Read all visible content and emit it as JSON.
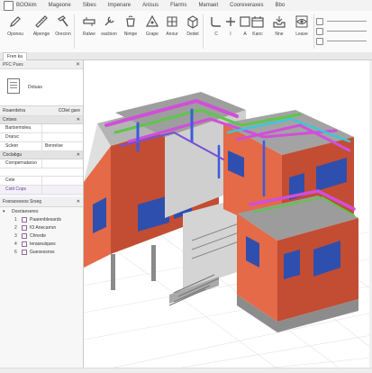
{
  "menubar": {
    "items": [
      "BOOkim",
      "Mageone",
      "Sibes",
      "Impenare",
      "Anisus",
      "Flarms",
      "Mamaet",
      "Coorexeraxes",
      "Bbo"
    ]
  },
  "ribbon": {
    "tools": [
      {
        "label": "Oponeu",
        "icon": "pencil-icon"
      },
      {
        "label": "Alpenge",
        "icon": "ruler-icon"
      },
      {
        "label": "Orecion",
        "icon": "hammer-icon"
      },
      {
        "label": "Ralwe",
        "icon": "pipe-icon"
      },
      {
        "label": "eacbion",
        "icon": "wrench-icon"
      },
      {
        "label": "Nimpe",
        "icon": "bucket-icon"
      },
      {
        "label": "Grape",
        "icon": "triangle-icon"
      },
      {
        "label": "Anour",
        "icon": "grid-icon"
      },
      {
        "label": "Dedet",
        "icon": "box-icon"
      },
      {
        "label": "C",
        "icon": "pipe-bend-icon"
      },
      {
        "label": "I",
        "icon": "plus-icon"
      },
      {
        "label": "A",
        "icon": "square-icon"
      },
      {
        "label": "Kanc",
        "icon": "calendar-icon"
      },
      {
        "label": "Nne",
        "icon": "tray-icon"
      },
      {
        "label": "Leave",
        "icon": "eye-icon"
      }
    ]
  },
  "tabstrip": {
    "active_tab": "Fren ka"
  },
  "left": {
    "properties_title": "PFC Pues",
    "doc_value": "Dotuas",
    "resources_title": "Roaerdetra",
    "resources_right": "COlet gare",
    "group1": "Cntses",
    "rows": [
      {
        "k": "Bartsemolea",
        "v": ""
      },
      {
        "k": "Draruc",
        "v": ""
      },
      {
        "k": "Scleer",
        "v": "Benrelse"
      }
    ],
    "group2": "Coclabgu",
    "rows2": [
      {
        "k": "Cornpernatarso",
        "v": ""
      },
      {
        "k": "Cete",
        "v": ""
      }
    ],
    "group3": "Cstit Cops",
    "tree_title": "Fosracesoos Srseg",
    "tree_group": "Dosriaeseres",
    "tree_items": [
      {
        "idx": "1",
        "label": "Paarenblesards"
      },
      {
        "idx": "2",
        "label": "IO Anecarrsn"
      },
      {
        "idx": "3",
        "label": "Chrerde"
      },
      {
        "idx": "4",
        "label": "Ieraseuiques"
      },
      {
        "idx": "6",
        "label": "Guesessnss"
      }
    ]
  },
  "colors": {
    "wall": "#d95a3a",
    "roof": "#9a9a9a",
    "pipe_magenta": "#d04fd8",
    "pipe_green": "#5ec64a",
    "pipe_blue": "#3a5be0",
    "pipe_cyan": "#3ac8d8",
    "window": "#2f4fae"
  }
}
